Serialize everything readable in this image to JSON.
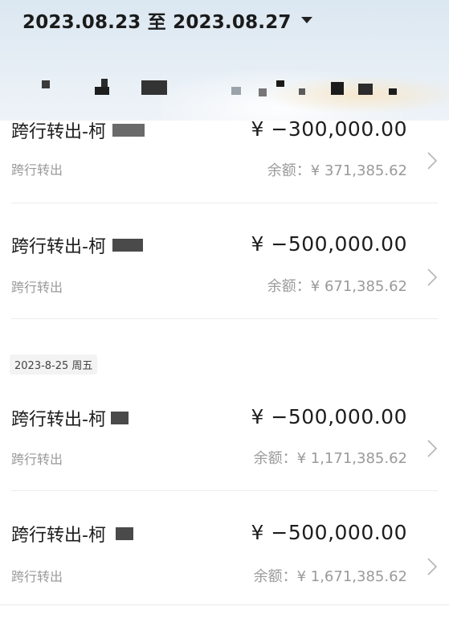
{
  "header": {
    "date_range": "2023.08.23 至 2023.08.27"
  },
  "date_group": "2023-8-25 周五",
  "transactions": [
    {
      "title": "跨行转出-柯",
      "amount": "¥ −300,000.00",
      "type": "跨行转出",
      "balance": "余额：¥ 371,385.62"
    },
    {
      "title": "跨行转出-柯",
      "amount": "¥ −500,000.00",
      "type": "跨行转出",
      "balance": "余额：¥ 671,385.62"
    },
    {
      "title": "跨行转出-柯",
      "amount": "¥ −500,000.00",
      "type": "跨行转出",
      "balance": "余额：¥ 1,171,385.62"
    },
    {
      "title": "跨行转出-柯",
      "amount": "¥ −500,000.00",
      "type": "跨行转出",
      "balance": "余额：¥ 1,671,385.62"
    }
  ]
}
